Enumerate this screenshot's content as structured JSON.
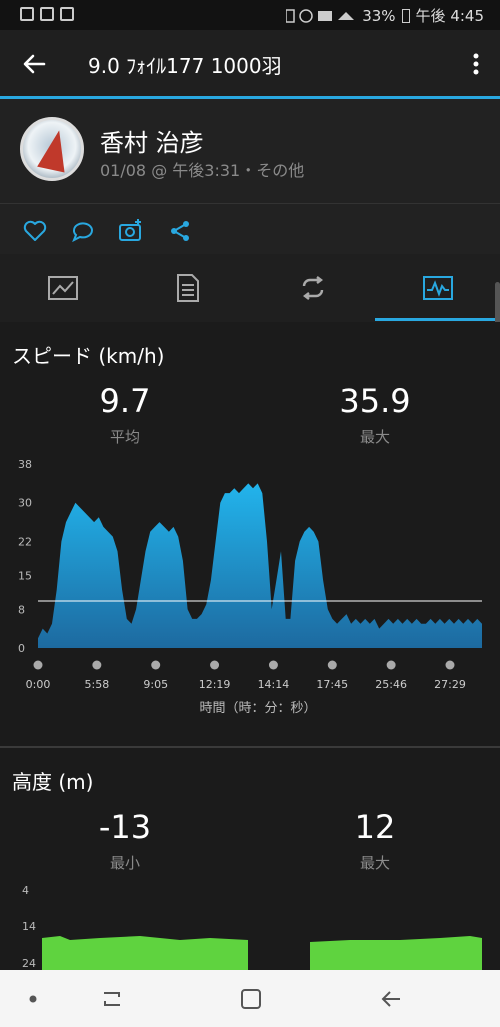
{
  "status_bar": {
    "battery": "33%",
    "time": "午後 4:45"
  },
  "toolbar": {
    "title": "9.0  ﾌｫｲﾙ177  1000羽"
  },
  "profile": {
    "name": "香村 治彦",
    "meta": "01/08 @ 午後3:31・その他"
  },
  "speed": {
    "title": "スピード (km/h)",
    "avg_value": "9.7",
    "avg_label": "平均",
    "max_value": "35.9",
    "max_label": "最大",
    "xlabel": "時間（時：分：秒）"
  },
  "altitude": {
    "title": "高度 (m)",
    "min_value": "-13",
    "min_label": "最小",
    "max_value": "12",
    "max_label": "最大"
  },
  "chart_data": [
    {
      "type": "area",
      "title": "スピード (km/h)",
      "xlabel": "時間（時：分：秒）",
      "ylabel": "",
      "ylim": [
        0,
        38
      ],
      "y_ticks": [
        "0",
        "8",
        "15",
        "22",
        "30",
        "38"
      ],
      "x_ticks": [
        "0:00",
        "5:58",
        "9:05",
        "12:19",
        "14:14",
        "17:45",
        "25:46",
        "27:29"
      ],
      "average_line": 9.7,
      "color": "#29a8e0",
      "series": [
        {
          "values": [
            2,
            4,
            3,
            5,
            12,
            22,
            26,
            28,
            30,
            29,
            28,
            27,
            26,
            27,
            25,
            24,
            23,
            20,
            12,
            6,
            5,
            8,
            14,
            20,
            24,
            25,
            26,
            25,
            24,
            25,
            23,
            18,
            8,
            6,
            6,
            7,
            9,
            14,
            22,
            30,
            32,
            32,
            33,
            32,
            33,
            34,
            33,
            34,
            32,
            22,
            8,
            14,
            20,
            6,
            6,
            18,
            22,
            24,
            25,
            24,
            22,
            14,
            8,
            6,
            5,
            6,
            7,
            5,
            6,
            5,
            6,
            5,
            6,
            4,
            5,
            6,
            5,
            6,
            5,
            6,
            5,
            6,
            5,
            5,
            6,
            5,
            6,
            5,
            6,
            5,
            6,
            5,
            6,
            5,
            6,
            5
          ]
        }
      ]
    },
    {
      "type": "area",
      "title": "高度 (m)",
      "xlabel": "",
      "ylabel": "",
      "y_ticks": [
        "4",
        "14",
        "24"
      ],
      "color": "#5fd33f"
    }
  ]
}
